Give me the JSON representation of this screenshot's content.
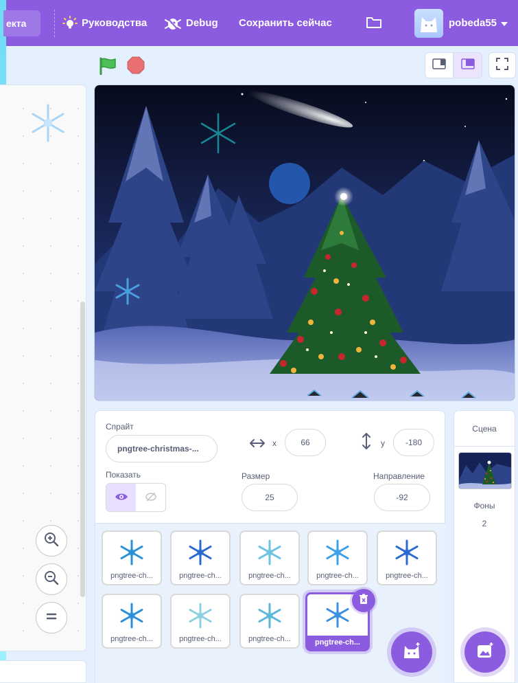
{
  "menubar": {
    "project_label": "екта",
    "tutorials_label": "Руководства",
    "debug_label": "Debug",
    "save_now_label": "Сохранить сейчас",
    "username": "pobeda55"
  },
  "colors": {
    "accent": "#8c5ce0",
    "menubar": "#8c5ce0",
    "background": "#e5f0ff",
    "flag": "#4cbf56",
    "stop": "#ec5959"
  },
  "icons": {
    "tutorials": "lightbulb-icon",
    "debug": "debug-bug-icon",
    "folder": "folder-icon",
    "flag": "green-flag-icon",
    "stop": "stop-icon",
    "small_stage": "small-stage-icon",
    "large_stage": "large-stage-icon",
    "fullscreen": "fullscreen-icon",
    "zoom_in": "zoom-in-icon",
    "zoom_out": "zoom-out-icon",
    "zoom_reset": "zoom-reset-icon",
    "show": "eye-icon",
    "hide": "eye-slash-icon",
    "delete": "trash-icon",
    "choose_sprite": "cat-icon",
    "choose_backdrop": "backdrop-icon"
  },
  "sprite_info": {
    "sprite_label": "Спрайт",
    "sprite_name": "pngtree-christmas-...",
    "x_label": "x",
    "x_value": "66",
    "y_label": "y",
    "y_value": "-180",
    "show_label": "Показать",
    "size_label": "Размер",
    "size_value": "25",
    "direction_label": "Направление",
    "direction_value": "-92"
  },
  "sprites": [
    {
      "name": "pngtree-ch..."
    },
    {
      "name": "pngtree-ch..."
    },
    {
      "name": "pngtree-ch..."
    },
    {
      "name": "pngtree-ch..."
    },
    {
      "name": "pngtree-ch..."
    },
    {
      "name": "pngtree-ch..."
    },
    {
      "name": "pngtree-ch..."
    },
    {
      "name": "pngtree-ch..."
    },
    {
      "name": "pngtree-ch...",
      "selected": true
    }
  ],
  "stage_panel": {
    "title": "Сцена",
    "backdrops_label": "Фоны",
    "backdrops_count": "2"
  }
}
